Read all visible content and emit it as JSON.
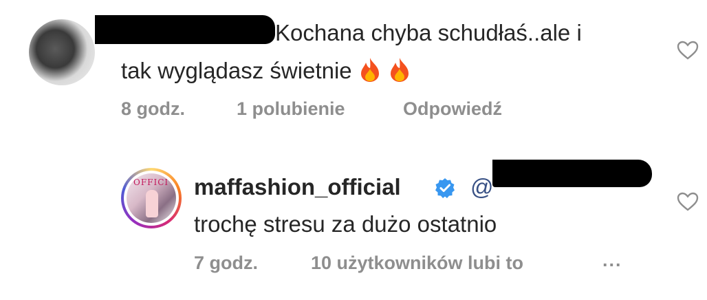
{
  "comment1": {
    "text_line1": "Kochana chyba schudłaś..ale i",
    "text_line2": "tak wyglądasz świetnie",
    "emoji": "fire-icon",
    "time": "8 godz.",
    "likes": "1 polubienie",
    "reply": "Odpowiedź"
  },
  "comment2": {
    "username": "maffashion_official",
    "mention": "@",
    "text": "trochę stresu za dużo ostatnio",
    "time": "7 godz.",
    "likes": "10 użytkowników lubi to",
    "more": "...",
    "avatar_text": "OFFICI"
  },
  "colors": {
    "text": "#262626",
    "meta": "#8e8e8e",
    "verified": "#3897f0",
    "mention": "#385185"
  }
}
